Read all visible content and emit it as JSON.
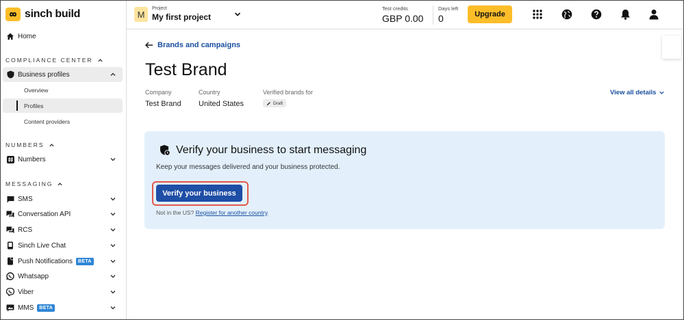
{
  "app": {
    "brand": "sinch build"
  },
  "topbar": {
    "project_label": "Project",
    "project_initial": "M",
    "project_name": "My first project",
    "credits_label": "Test credits",
    "credits_value": "GBP 0.00",
    "days_label": "Days left",
    "days_value": "0",
    "upgrade_label": "Upgrade",
    "icons": [
      "apps-grid-icon",
      "globe-icon",
      "help-icon",
      "bell-icon",
      "user-icon"
    ]
  },
  "sidebar": {
    "home": "Home",
    "compliance_title": "COMPLIANCE CENTER",
    "business_profiles": "Business profiles",
    "sub_items": [
      "Overview",
      "Profiles",
      "Content providers"
    ],
    "numbers_title": "NUMBERS",
    "numbers": "Numbers",
    "messaging_title": "MESSAGING",
    "messaging_items": [
      {
        "label": "SMS",
        "icon": "sms-icon"
      },
      {
        "label": "Conversation API",
        "icon": "chat-icon"
      },
      {
        "label": "RCS",
        "icon": "rcs-icon"
      },
      {
        "label": "Sinch Live Chat",
        "icon": "live-chat-icon"
      },
      {
        "label": "Push Notifications",
        "icon": "push-icon",
        "badge": "BETA"
      },
      {
        "label": "Whatsapp",
        "icon": "whatsapp-icon"
      },
      {
        "label": "Viber",
        "icon": "viber-icon"
      },
      {
        "label": "MMS",
        "icon": "mms-icon",
        "badge": "BETA"
      }
    ]
  },
  "main": {
    "back_link": "Brands and campaigns",
    "brand_title": "Test Brand",
    "company_label": "Company",
    "company_value": "Test Brand",
    "country_label": "Country",
    "country_value": "United States",
    "verified_label": "Verified brands for",
    "draft_badge": "Draft",
    "view_all": "View all details",
    "verify": {
      "title": "Verify your business to start messaging",
      "description": "Keep your messages delivered and your business protected.",
      "button": "Verify your business",
      "not_us_prefix": "Not in the US?",
      "register_link": "Register for another country",
      "suffix": "."
    }
  },
  "colors": {
    "accent": "#fdbd29",
    "link": "#1a4fa0",
    "primary_button": "#1e4ea6",
    "card_bg": "#e3f0fb",
    "highlight": "#e2574c",
    "beta": "#2f86d6"
  }
}
